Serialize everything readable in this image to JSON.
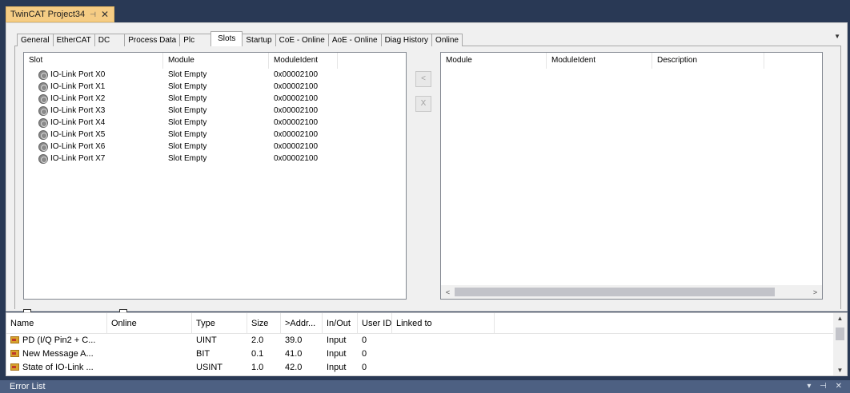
{
  "document_tab": {
    "title": "TwinCAT Project34",
    "pin_glyph": "⊣",
    "close_glyph": "✕"
  },
  "tabs": [
    "General",
    "EtherCAT",
    "DC",
    "Process Data",
    "Plc",
    "Slots",
    "Startup",
    "CoE - Online",
    "AoE - Online",
    "Diag History",
    "Online"
  ],
  "active_tab": "Slots",
  "slots_table": {
    "headers": {
      "slot": "Slot",
      "module": "Module",
      "ident": "ModuleIdent"
    },
    "rows": [
      {
        "slot": "IO-Link Port X0",
        "module": "Slot Empty",
        "ident": "0x00002100"
      },
      {
        "slot": "IO-Link Port X1",
        "module": "Slot Empty",
        "ident": "0x00002100"
      },
      {
        "slot": "IO-Link Port X2",
        "module": "Slot Empty",
        "ident": "0x00002100"
      },
      {
        "slot": "IO-Link Port X3",
        "module": "Slot Empty",
        "ident": "0x00002100"
      },
      {
        "slot": "IO-Link Port X4",
        "module": "Slot Empty",
        "ident": "0x00002100"
      },
      {
        "slot": "IO-Link Port X5",
        "module": "Slot Empty",
        "ident": "0x00002100"
      },
      {
        "slot": "IO-Link Port X6",
        "module": "Slot Empty",
        "ident": "0x00002100"
      },
      {
        "slot": "IO-Link Port X7",
        "module": "Slot Empty",
        "ident": "0x00002100"
      }
    ]
  },
  "mid_buttons": {
    "insert": "<",
    "remove": "X"
  },
  "modules_table": {
    "headers": {
      "module": "Module",
      "ident": "ModuleIdent",
      "description": "Description"
    }
  },
  "variables_table": {
    "headers": {
      "name": "Name",
      "online": "Online",
      "type": "Type",
      "size": "Size",
      "addr": ">Addr...",
      "inout": "In/Out",
      "userid": "User ID",
      "linked": "Linked to"
    },
    "rows": [
      {
        "name": "PD (I/Q Pin2 + C...",
        "online": "",
        "type": "UINT",
        "size": "2.0",
        "addr": "39.0",
        "inout": "Input",
        "userid": "0",
        "linked": ""
      },
      {
        "name": "New Message A...",
        "online": "",
        "type": "BIT",
        "size": "0.1",
        "addr": "41.0",
        "inout": "Input",
        "userid": "0",
        "linked": ""
      },
      {
        "name": "State of IO-Link ...",
        "online": "",
        "type": "USINT",
        "size": "1.0",
        "addr": "42.0",
        "inout": "Input",
        "userid": "0",
        "linked": ""
      }
    ]
  },
  "error_list": {
    "title": "Error List",
    "controls": "▾ ⊣ ✕"
  },
  "colors": {
    "doc_tab": "#f5cc84",
    "ide_background": "#293955",
    "error_bar": "#4d6082"
  }
}
